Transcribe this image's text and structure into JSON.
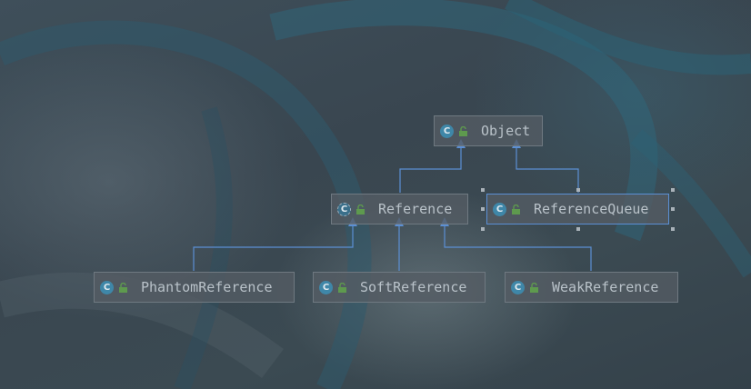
{
  "colors": {
    "edge": "#5b8fd4",
    "class_icon": "#3f87a8",
    "lock_icon": "#5e9a4e",
    "node_text": "#b9c2c9"
  },
  "icons": {
    "class": "class-icon",
    "abstract_class": "abstract-class-icon",
    "visibility": "lock-icon"
  },
  "class_icon_letter": "C",
  "nodes": {
    "object": {
      "name": "Object"
    },
    "reference": {
      "name": "Reference"
    },
    "reference_queue": {
      "name": "ReferenceQueue"
    },
    "phantom_reference": {
      "name": "PhantomReference"
    },
    "soft_reference": {
      "name": "SoftReference"
    },
    "weak_reference": {
      "name": "WeakReference"
    }
  },
  "edges": [
    {
      "from": "reference",
      "to": "object"
    },
    {
      "from": "reference_queue",
      "to": "object"
    },
    {
      "from": "phantom_reference",
      "to": "reference"
    },
    {
      "from": "soft_reference",
      "to": "reference"
    },
    {
      "from": "weak_reference",
      "to": "reference"
    }
  ]
}
